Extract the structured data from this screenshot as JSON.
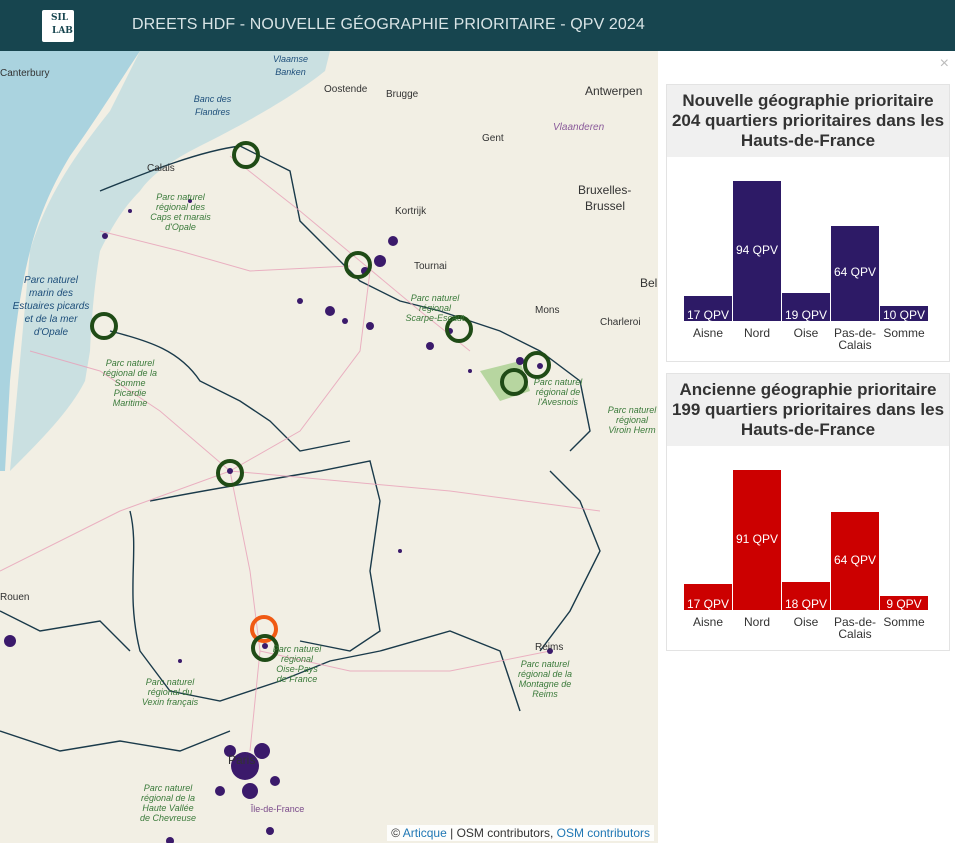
{
  "header": {
    "title": "DREETS HDF - NOUVELLE GÉOGRAPHIE PRIORITAIRE - QPV 2024",
    "logo_text": "SIL LAB"
  },
  "map": {
    "cities": [
      {
        "name": "Canterbury"
      },
      {
        "name": "Oostende"
      },
      {
        "name": "Brugge"
      },
      {
        "name": "Antwerpen"
      },
      {
        "name": "Gent"
      },
      {
        "name": "Bruxelles-"
      },
      {
        "name": "Brussel"
      },
      {
        "name": "Kortrijk"
      },
      {
        "name": "Tournai"
      },
      {
        "name": "Mons"
      },
      {
        "name": "Charleroi"
      },
      {
        "name": "Calais"
      },
      {
        "name": "Reims"
      },
      {
        "name": "Paris"
      },
      {
        "name": "Rouen"
      },
      {
        "name": "Vlaanderen"
      },
      {
        "name": "Bel"
      }
    ],
    "labels": {
      "vlaamse": "Vlaamse Banken",
      "banc": "Banc des Flandres",
      "marin": "Parc naturel marin des Estuaires picards et de la mer d'Opale",
      "caps": "Parc naturel régional des Caps et marais d'Opale",
      "somme": "Parc naturel régional de la Somme Picardie Maritime",
      "scarpe": "Parc naturel régional Scarpe-Escaut",
      "avesnois": "Parc naturel régional de l'Avesnois",
      "hirson": "Parc naturel régional Viroin Herm",
      "oise": "Parc naturel régional Oise-Pays de France",
      "vexin": "Parc naturel régional du Vexin français",
      "reims": "Parc naturel régional de la Montagne de Reims",
      "chevreuse": "Parc naturel régional de la Haute Vallée de Chevreuse",
      "iledefrance": "Île-de-France"
    },
    "attribution": {
      "prefix": "©",
      "link1": "Articque",
      "sep": "| OSM contributors,",
      "link2": "OSM contributors"
    },
    "colors": {
      "sea": "#aad3df",
      "land": "#f2efe4",
      "qpv": "#3b1a6b",
      "marker_new": "#1f4b16",
      "marker_old": "#f05a14",
      "border": "#1a3a4a"
    }
  },
  "panel": {
    "close_label": "×",
    "new_title": "Nouvelle géographie prioritaire 204 quartiers prioritaires dans les Hauts-de-France",
    "old_title": "Ancienne géographie prioritaire 199 quartiers prioritaires dans les Hauts-de-France"
  },
  "chart_data": [
    {
      "type": "bar",
      "title": "Nouvelle géographie prioritaire 204 quartiers prioritaires dans les Hauts-de-France",
      "categories": [
        "Aisne",
        "Nord",
        "Oise",
        "Pas-de-Calais",
        "Somme"
      ],
      "values": [
        17,
        94,
        19,
        64,
        10
      ],
      "value_labels": [
        "17 QPV",
        "94 QPV",
        "19 QPV",
        "64 QPV",
        "10 QPV"
      ],
      "color": "#2d1a66",
      "ylim": [
        0,
        94
      ]
    },
    {
      "type": "bar",
      "title": "Ancienne géographie prioritaire 199 quartiers prioritaires dans les Hauts-de-France",
      "categories": [
        "Aisne",
        "Nord",
        "Oise",
        "Pas-de-Calais",
        "Somme"
      ],
      "values": [
        17,
        91,
        18,
        64,
        9
      ],
      "value_labels": [
        "17 QPV",
        "91 QPV",
        "18 QPV",
        "64 QPV",
        "9 QPV"
      ],
      "color": "#cc0000",
      "ylim": [
        0,
        91
      ]
    }
  ]
}
